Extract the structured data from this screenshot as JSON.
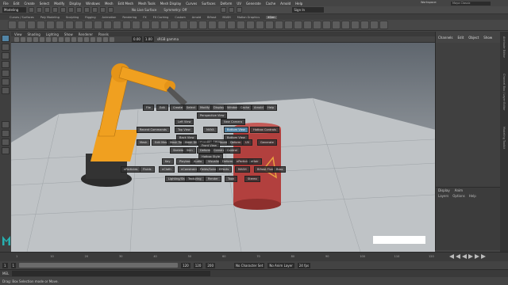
{
  "menubar": {
    "items": [
      "File",
      "Edit",
      "Create",
      "Select",
      "Modify",
      "Display",
      "Windows",
      "Mesh",
      "Edit Mesh",
      "Mesh Tools",
      "Mesh Display",
      "Curves",
      "Surfaces",
      "Deform",
      "UV",
      "Generate",
      "Cache",
      "Arnold",
      "Help"
    ],
    "workspace": "Workspace:",
    "search_placeholder": "Maya Classic"
  },
  "statusline": {
    "mode": "Modeling",
    "no_live": "No Live Surface",
    "symmetry": "Symmetry: Off",
    "signin": "Sign In"
  },
  "shelf": {
    "tabs": [
      "Curves / Surfaces",
      "Poly Modeling",
      "Sculpting",
      "Rigging",
      "Animation",
      "Rendering",
      "FX",
      "FX Caching",
      "Custom",
      "Arnold",
      "Bifrost",
      "MASH",
      "Motion Graphics",
      "XGen"
    ],
    "active_tab": "XGen"
  },
  "viewport": {
    "menu": [
      "View",
      "Shading",
      "Lighting",
      "Show",
      "Renderer",
      "Panels"
    ],
    "gamma": "sRGB gamma",
    "exposure": "0.00",
    "gamma_val": "1.00",
    "selection_text": ""
  },
  "channel_box": {
    "tabs": [
      "Channels",
      "Edit",
      "Object",
      "Show"
    ]
  },
  "layers": {
    "tabs": [
      "Display",
      "Anim"
    ],
    "options": [
      "Layers",
      "Options",
      "Help"
    ]
  },
  "side_tabs": [
    "Attribute Editor",
    "Channel Box / Layer Editor",
    "Modeling Toolkit"
  ],
  "hotbox": {
    "top_row": [
      "File",
      "Edit",
      "Create",
      "Select",
      "Modify",
      "Display",
      "Windows",
      "Cache",
      "Arnold",
      "Help"
    ],
    "perspective": "Perspective View",
    "left_view": "Left View",
    "top_view": "Top View",
    "new_camera": "New Camera",
    "back_view": "Back View",
    "bottom_view": "Bottom View",
    "front_view": "Front View",
    "recent": "Recent Commands",
    "hotbox_label": "Hotbox Controls",
    "maya": "MAYA",
    "mid_row": [
      "Mesh",
      "Edit Mesh",
      "Mesh Tools",
      "Mesh Display",
      "Curves",
      "Surfaces",
      "Deform",
      "UV",
      "Generate"
    ],
    "row3": [
      "Skeleton",
      "Skin",
      "Deform",
      "Constrain",
      "Control"
    ],
    "hotbox_style": "Hotbox Style",
    "row4": [
      "Key",
      "Playback",
      "Audio",
      "Visualize",
      "Deform",
      "nParticles",
      "nHair"
    ],
    "row5": [
      "nParticles",
      "Fluids",
      "nCloth",
      "nConstraint",
      "Fields/Solvers",
      "Effects",
      "MASH",
      "Bifrost Fluids",
      "Boss"
    ],
    "row6": [
      "Lighting/Shading",
      "Texturing",
      "Render",
      "Toon",
      "Stereo"
    ],
    "view": "View",
    "show": "Show",
    "shading": "Shading",
    "lighting": "Lighting",
    "panels": "Panels",
    "view2": "View"
  },
  "timeslider": {
    "ticks": [
      "1",
      "10",
      "20",
      "30",
      "40",
      "50",
      "60",
      "70",
      "80",
      "90",
      "100",
      "110",
      "120"
    ]
  },
  "rangeslider": {
    "start": "1",
    "start2": "1",
    "end": "120",
    "end2": "120",
    "end3": "200",
    "char_set": "No Character Set",
    "anim_layer": "No Anim Layer",
    "fps": "24 fps"
  },
  "cmdline": {
    "label": "MEL"
  },
  "helpline": {
    "text": "Drag: Box Selection mode or Move."
  },
  "colors": {
    "robot": "#f0a020",
    "barrel": "#b2403e",
    "accent": "#5285a6"
  }
}
